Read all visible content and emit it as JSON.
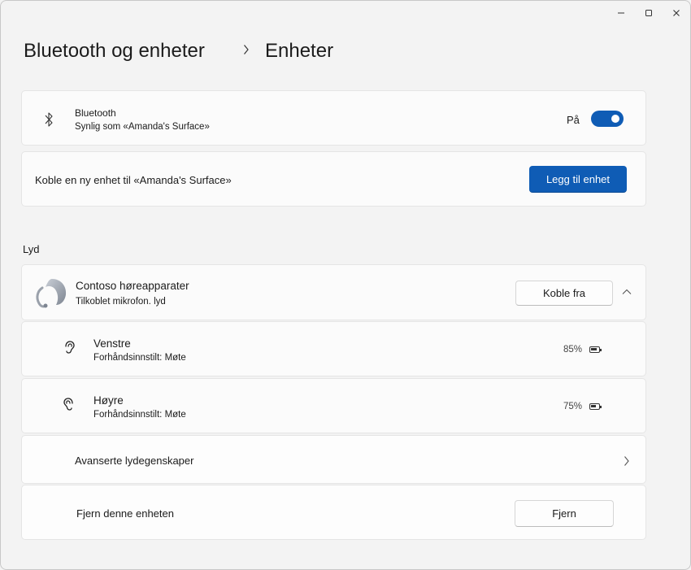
{
  "window": {
    "controls": {
      "minimize": "–",
      "maximize": "▢",
      "close": "✕"
    }
  },
  "breadcrumb": {
    "parent": "Bluetooth og enheter",
    "separator": "›",
    "current": "Enheter"
  },
  "bluetooth": {
    "title": "Bluetooth",
    "subtitle": "Synlig som «Amanda's Surface»",
    "toggle_label": "På",
    "toggle_on": true
  },
  "add_device": {
    "text": "Koble en ny enhet til «Amanda's Surface»",
    "button": "Legg til enhet"
  },
  "section": {
    "title": "Lyd"
  },
  "device": {
    "name": "Contoso høreapparater",
    "status": "Tilkoblet mikrofon. lyd",
    "disconnect_button": "Koble fra",
    "sub_devices": [
      {
        "name": "Venstre",
        "preset": "Forhåndsinnstilt: Møte",
        "battery": "85%",
        "battery_level": 0.85
      },
      {
        "name": "Høyre",
        "preset": "Forhåndsinnstilt: Møte",
        "battery": "75%",
        "battery_level": 0.75
      }
    ]
  },
  "advanced": {
    "label": "Avanserte lydegenskaper"
  },
  "remove": {
    "label": "Fjern denne enheten",
    "button": "Fjern"
  },
  "colors": {
    "accent": "#0f5cb5",
    "background": "#f3f3f3",
    "card": "#fbfbfb"
  }
}
